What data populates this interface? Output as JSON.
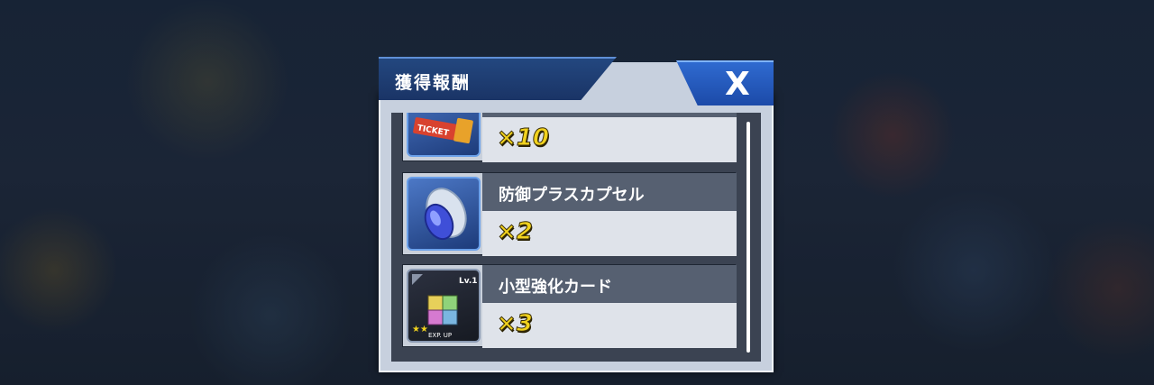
{
  "dialog": {
    "title": "獲得報酬",
    "close_label": "X"
  },
  "rewards": [
    {
      "name": "",
      "quantity": "×10",
      "icon": "ticket-icon",
      "icon_text": "TICKET"
    },
    {
      "name": "防御プラスカプセル",
      "quantity": "×2",
      "icon": "capsule-icon"
    },
    {
      "name": "小型強化カード",
      "quantity": "×3",
      "icon": "exp-cube-icon",
      "icon_level": "Lv.1",
      "icon_caption": "EXP. UP",
      "icon_stars": "★★"
    }
  ],
  "colors": {
    "title_bar": "#23477f",
    "close_button": "#2f6ad0",
    "quantity_text": "#f1d21e",
    "panel_bg": "#c7d0de"
  }
}
